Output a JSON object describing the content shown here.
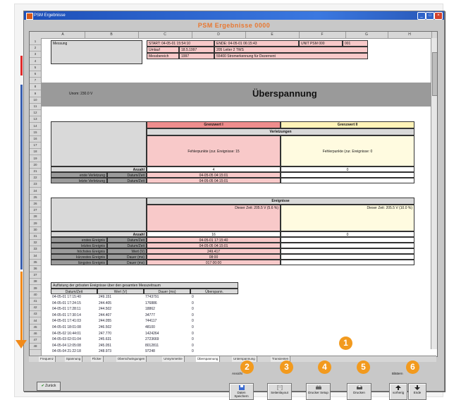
{
  "window": {
    "title": "PSM Ergebnisse",
    "banner": "PSM Ergebnisse 0000",
    "controls": [
      "_",
      "□",
      "×"
    ]
  },
  "columns": [
    "A",
    "B",
    "C",
    "D",
    "E",
    "F",
    "G",
    "H"
  ],
  "rows": [
    "1",
    "2",
    "3",
    "4",
    "5",
    "6",
    "7",
    "8",
    "9",
    "10",
    "11",
    "12",
    "13",
    "14",
    "15",
    "16",
    "17",
    "18",
    "19",
    "20",
    "21",
    "22",
    "23",
    "24",
    "25",
    "26",
    "27",
    "28",
    "29",
    "30",
    "31",
    "32",
    "33",
    "34",
    "35",
    "36",
    "37",
    "38",
    "39",
    "40",
    "41",
    "42",
    "43",
    "44",
    "45",
    "46",
    "47",
    "48"
  ],
  "header": {
    "messung_label": "Messung",
    "start": "START: 04-05-01 15:54:10",
    "ende": "ENDE: 04-05-01 06:15:43",
    "unit_id": "UNIT PSM 000",
    "unit_num": "001",
    "umlauf_label": "Umlauf",
    "umlauf_value": "18.5.1997",
    "umlauf_right": "205 Leiter 2 TWS",
    "messbereich_label": "Messbereich",
    "messbereich_value": "1997",
    "messbereich_right": "55400 Stromerkennung für Dezernent",
    "unom": "Unom: 230.0 V"
  },
  "section_title": "Überspannung",
  "grenzwerte": {
    "g1": "Grenzwert I",
    "g2": "Grenzwert II",
    "verletzungen": "Verletzungen",
    "fehler1": "Fehlerpunkte (zur. Ereignisse: 15",
    "fehler2": "Fehlerpunkte (zur. Ereignisse: 0",
    "anzahl": "Anzahl",
    "anzahl_val1": "4",
    "anzahl_val2": "0",
    "erste": "erste Verletzung",
    "letzte": "letzte Verletzung",
    "datum": "Datum/Zeit",
    "erste_val": "04-05-05 04:15:01",
    "letzte_val": "04-05-05 04:15:01"
  },
  "ereignisse": {
    "title": "Ereignisse",
    "g1_text": "Dieser Zeit: 205.5 V (5.6 %)",
    "g2_text": "Dieser Zeit: 205.5 V (10.0 %)",
    "anzahl": "Anzahl",
    "anzahl_val1": "16",
    "anzahl_val2": "0",
    "rows": [
      {
        "label": "erstes Ereignis",
        "key": "Datum/Zeit",
        "val": "04-05-01 17:15:40"
      },
      {
        "label": "letztes Ereignis",
        "key": "Datum/Zeit",
        "val": "04-05-05 04:15:01"
      },
      {
        "label": "höchstes Ereignis",
        "key": "Wert (V)",
        "val": "249.417"
      },
      {
        "label": "kürzestes Ereignis",
        "key": "Dauer (ms)",
        "val": "08:00"
      },
      {
        "label": "längstes Ereignis",
        "key": "Dauer (ms)",
        "val": "017:00:00"
      }
    ]
  },
  "list": {
    "caption": "Auflistung der grössten Ereignisse über den gesamten Messzeitraum",
    "headers": [
      "Datum/Zeit",
      "Wert (V)",
      "Dauer (ms)",
      "Überspann."
    ],
    "rows": [
      [
        "04-05-01 17:15:40",
        "249.151",
        "7743791",
        "0"
      ],
      [
        "04-05-01 17:24:15",
        "244.405",
        "176886",
        "0"
      ],
      [
        "04-05-01 17:28:11",
        "244.502",
        "18862",
        "0"
      ],
      [
        "04-05-01 17:30:14",
        "244.407",
        "34777",
        "0"
      ],
      [
        "04-05-01 17:41:03",
        "244.055",
        "744117",
        "0"
      ],
      [
        "04-05-01 18:01:08",
        "246.502",
        "48100",
        "0"
      ],
      [
        "04-05-02 16:44:01",
        "247.770",
        "1424264",
        "0"
      ],
      [
        "04-05-03 02:01:04",
        "245.631",
        "2723669",
        "0"
      ],
      [
        "04-05-04 12:05:08",
        "245.051",
        "8012811",
        "0"
      ],
      [
        "04-05-04 21:22:18",
        "248.973",
        "97248",
        "0"
      ]
    ]
  },
  "sheet_tabs": [
    "Frequenz",
    "Spannung",
    "Flicker",
    "Oberschwingungen",
    "Unsymmetrie",
    "Überspannung",
    "Unterspannung",
    "Transienten"
  ],
  "active_tab": "Überspannung",
  "toolbar": {
    "back_label": "Zurück",
    "group1_label": "Ansicht",
    "group2_label": "Blättern",
    "b1": "Daten Speichern",
    "b2": "Seitenlayout",
    "b3": "Drucker Setup",
    "b4": "Drucken",
    "b5": "vorherig",
    "b6": "Ende"
  },
  "markers": [
    "1",
    "2",
    "3",
    "4",
    "5",
    "6"
  ]
}
